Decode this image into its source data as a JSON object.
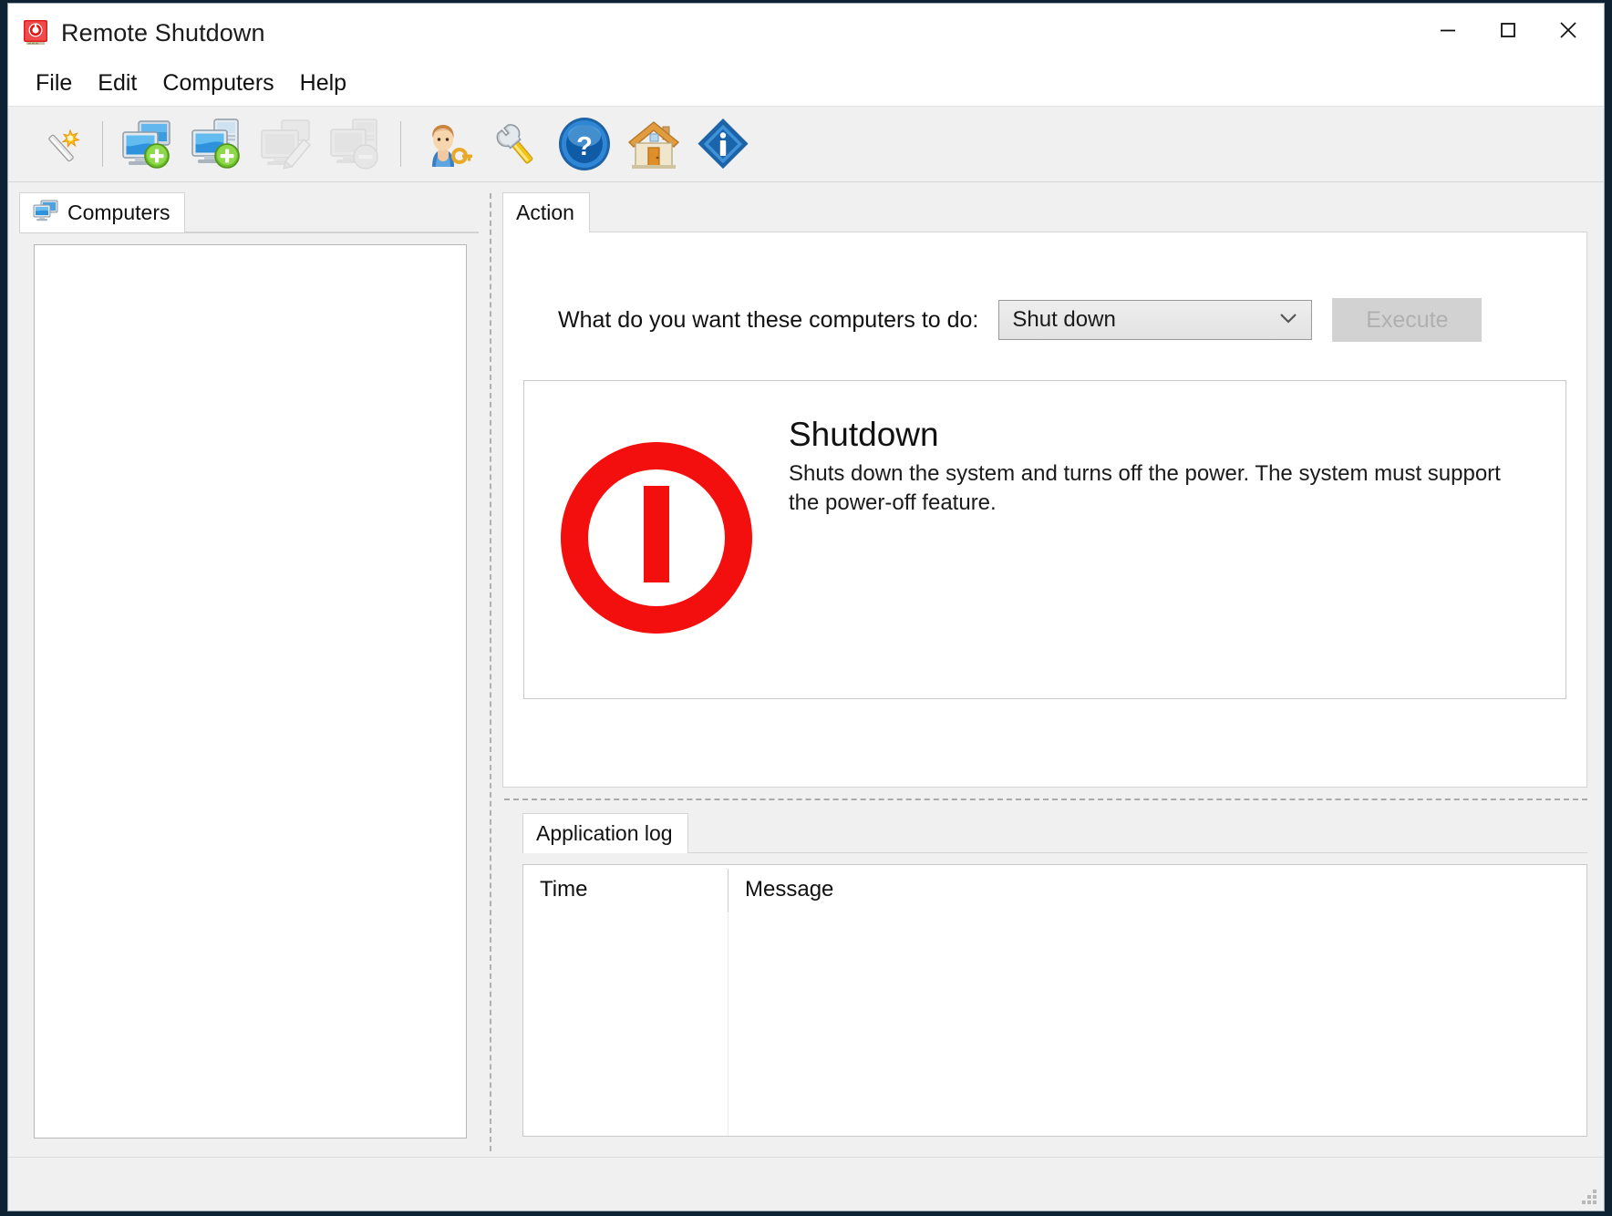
{
  "window": {
    "title": "Remote Shutdown",
    "icon": "power-shutdown-icon",
    "minimize_label": "—",
    "maximize_label": "☐",
    "close_label": "✕"
  },
  "menubar": {
    "items": [
      {
        "label": "File",
        "name": "menu-file"
      },
      {
        "label": "Edit",
        "name": "menu-edit"
      },
      {
        "label": "Computers",
        "name": "menu-computers"
      },
      {
        "label": "Help",
        "name": "menu-help"
      }
    ]
  },
  "toolbar": {
    "buttons": [
      {
        "name": "wizard-icon",
        "title": "Wizard",
        "enabled": true
      },
      {
        "name": "add-computer-icon",
        "title": "Add computer",
        "enabled": true
      },
      {
        "name": "add-computer-from-list-icon",
        "title": "Add computers",
        "enabled": true
      },
      {
        "name": "edit-computer-icon",
        "title": "Edit computer",
        "enabled": false
      },
      {
        "name": "remove-computer-icon",
        "title": "Remove computer",
        "enabled": false
      },
      {
        "name": "credentials-icon",
        "title": "Credentials",
        "enabled": true
      },
      {
        "name": "settings-wrench-icon",
        "title": "Settings",
        "enabled": true
      },
      {
        "name": "help-question-icon",
        "title": "Help",
        "enabled": true
      },
      {
        "name": "home-icon",
        "title": "Home page",
        "enabled": true
      },
      {
        "name": "about-info-icon",
        "title": "About",
        "enabled": true
      }
    ]
  },
  "left_pane": {
    "tab": {
      "label": "Computers",
      "icon": "computers-icon"
    },
    "list_items": []
  },
  "action_panel": {
    "tab_label": "Action",
    "question_label": "What do you want these computers to do:",
    "select": {
      "value": "Shut down",
      "options": [
        "Shut down"
      ],
      "chevron": "chevron-down-icon"
    },
    "execute_button": {
      "label": "Execute",
      "enabled": false
    },
    "info": {
      "icon": "power-symbol-icon",
      "icon_color": "#f40f0f",
      "title": "Shutdown",
      "description": "Shuts down the system and turns off the power. The system must support the power-off feature."
    }
  },
  "log_panel": {
    "tab_label": "Application log",
    "columns": [
      "Time",
      "Message"
    ],
    "rows": []
  },
  "statusbar": {
    "text": "",
    "grip": "resize-grip-icon"
  },
  "colors": {
    "accent_red": "#f40f0f",
    "window_bg": "#f0f0f0",
    "panel_bg": "#ffffff",
    "border": "#d4d4d4"
  }
}
